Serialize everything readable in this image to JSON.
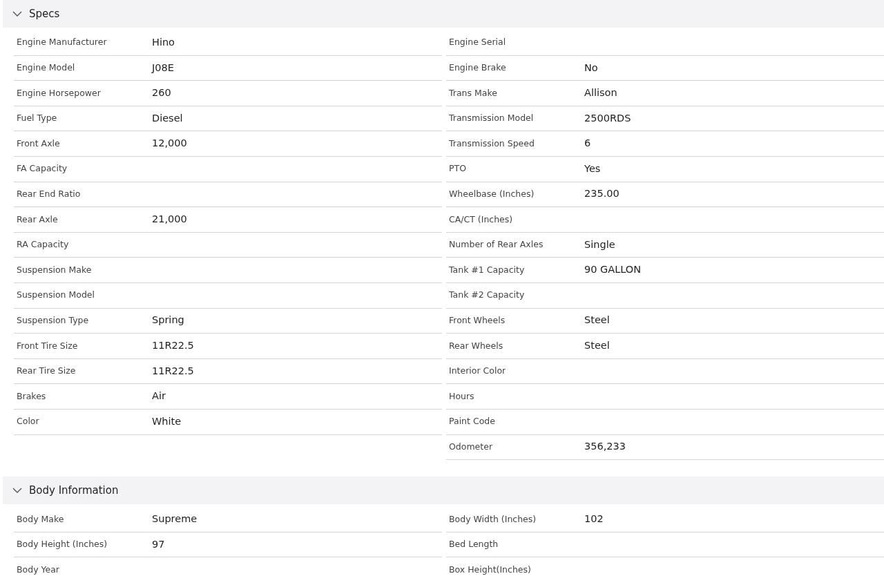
{
  "sections": [
    {
      "title": "Specs",
      "expanded": true,
      "left": [
        {
          "label": "Engine Manufacturer",
          "value": "Hino"
        },
        {
          "label": "Engine Model",
          "value": "J08E"
        },
        {
          "label": "Engine Horsepower",
          "value": "260"
        },
        {
          "label": "Fuel Type",
          "value": "Diesel"
        },
        {
          "label": "Front Axle",
          "value": "12,000"
        },
        {
          "label": "FA Capacity"
        },
        {
          "label": "Rear End Ratio"
        },
        {
          "label": "Rear Axle",
          "value": "21,000"
        },
        {
          "label": "RA Capacity"
        },
        {
          "label": "Suspension Make"
        },
        {
          "label": "Suspension Model"
        },
        {
          "label": "Suspension Type",
          "value": "Spring"
        },
        {
          "label": "Front Tire Size",
          "value": "11R22.5"
        },
        {
          "label": "Rear Tire Size",
          "value": "11R22.5"
        },
        {
          "label": "Brakes",
          "value": "Air"
        },
        {
          "label": "Color",
          "value": "White"
        }
      ],
      "right": [
        {
          "label": "Engine Serial"
        },
        {
          "label": "Engine Brake",
          "value": "No"
        },
        {
          "label": "Trans Make",
          "value": "Allison"
        },
        {
          "label": "Transmission Model",
          "value": "2500RDS"
        },
        {
          "label": "Transmission Speed",
          "value": "6"
        },
        {
          "label": "PTO",
          "value": "Yes"
        },
        {
          "label": "Wheelbase (Inches)",
          "value": "235.00"
        },
        {
          "label": "CA/CT (Inches)"
        },
        {
          "label": "Number of Rear Axles",
          "value": "Single"
        },
        {
          "label": "Tank #1 Capacity",
          "value": "90 GALLON"
        },
        {
          "label": "Tank #2 Capacity"
        },
        {
          "label": "Front Wheels",
          "value": "Steel"
        },
        {
          "label": "Rear Wheels",
          "value": "Steel"
        },
        {
          "label": "Interior Color"
        },
        {
          "label": "Hours"
        },
        {
          "label": "Paint Code"
        },
        {
          "label": "Odometer",
          "value": "356,233"
        }
      ]
    },
    {
      "title": "Body Information",
      "expanded": true,
      "left": [
        {
          "label": "Body Make",
          "value": "Supreme"
        },
        {
          "label": "Body Height (Inches)",
          "value": "97"
        },
        {
          "label": "Body Year"
        }
      ],
      "right": [
        {
          "label": "Body Width (Inches)",
          "value": "102"
        },
        {
          "label": "Bed Length"
        },
        {
          "label": "Box Height(Inches)"
        }
      ]
    }
  ]
}
